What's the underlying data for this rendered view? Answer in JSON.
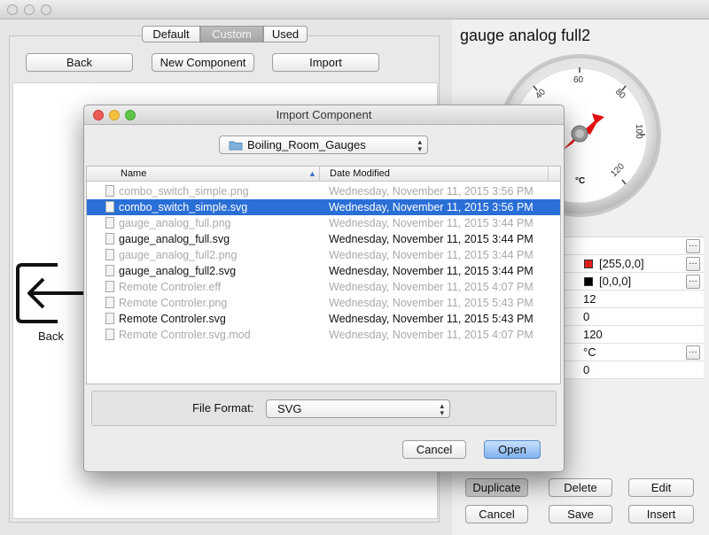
{
  "tabs": [
    "Default",
    "Custom",
    "Used"
  ],
  "left_buttons": {
    "back": "Back",
    "new_component": "New Component",
    "import": "Import"
  },
  "back_tile_label": "Back",
  "gauge": {
    "title": "gauge analog full2",
    "ticks": [
      "40",
      "60",
      "80",
      "100",
      "120"
    ],
    "unit": "°C"
  },
  "properties": {
    "rows": [
      {
        "value": ""
      },
      {
        "value": "[255,0,0]",
        "swatch": "#e31d1d",
        "has_dots": true
      },
      {
        "value": "[0,0,0]",
        "swatch": "#000000",
        "has_dots": true
      },
      {
        "value": "12"
      },
      {
        "value": "0"
      },
      {
        "value": "120"
      },
      {
        "value": "°C",
        "has_dots": true
      },
      {
        "value": "0"
      }
    ]
  },
  "bottom_buttons": {
    "duplicate": "Duplicate",
    "delete": "Delete",
    "edit": "Edit",
    "cancel": "Cancel",
    "save": "Save",
    "insert": "Insert"
  },
  "dialog": {
    "title": "Import Component",
    "folder": "Boiling_Room_Gauges",
    "columns": {
      "name": "Name",
      "date": "Date Modified"
    },
    "files": [
      {
        "name": "combo_switch_simple.png",
        "date": "Wednesday, November 11, 2015 3:56 PM",
        "enabled": false,
        "selected": false
      },
      {
        "name": "combo_switch_simple.svg",
        "date": "Wednesday, November 11, 2015 3:56 PM",
        "enabled": true,
        "selected": true
      },
      {
        "name": "gauge_analog_full.png",
        "date": "Wednesday, November 11, 2015 3:44 PM",
        "enabled": false,
        "selected": false
      },
      {
        "name": "gauge_analog_full.svg",
        "date": "Wednesday, November 11, 2015 3:44 PM",
        "enabled": true,
        "selected": false
      },
      {
        "name": "gauge_analog_full2.png",
        "date": "Wednesday, November 11, 2015 3:44 PM",
        "enabled": false,
        "selected": false
      },
      {
        "name": "gauge_analog_full2.svg",
        "date": "Wednesday, November 11, 2015 3:44 PM",
        "enabled": true,
        "selected": false
      },
      {
        "name": "Remote Controler.eff",
        "date": "Wednesday, November 11, 2015 4:07 PM",
        "enabled": false,
        "selected": false
      },
      {
        "name": "Remote Controler.png",
        "date": "Wednesday, November 11, 2015 5:43 PM",
        "enabled": false,
        "selected": false
      },
      {
        "name": "Remote Controler.svg",
        "date": "Wednesday, November 11, 2015 5:43 PM",
        "enabled": true,
        "selected": false
      },
      {
        "name": "Remote Controler.svg.mod",
        "date": "Wednesday, November 11, 2015 4:07 PM",
        "enabled": false,
        "selected": false
      }
    ],
    "file_format_label": "File Format:",
    "file_format_value": "SVG",
    "cancel": "Cancel",
    "open": "Open"
  },
  "colors": {
    "selection": "#2a6fd6",
    "needle": "#e01010",
    "open_button": "#7fb2ee"
  }
}
